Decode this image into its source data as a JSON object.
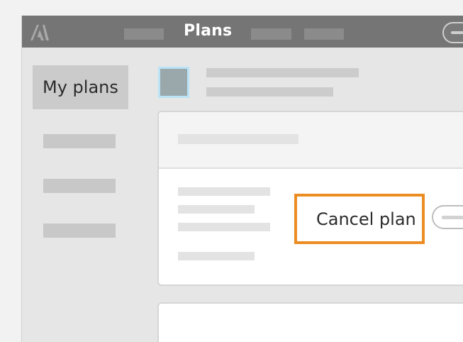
{
  "header": {
    "title": "Plans",
    "logo_icon": "adobe-logo-icon"
  },
  "sidebar": {
    "active_item_label": "My plans"
  },
  "plan_card": {
    "cancel_button_label": "Cancel plan"
  },
  "colors": {
    "topbar": "#757575",
    "highlight": "#ec8d24",
    "avatar_border": "#b9e2f6"
  }
}
